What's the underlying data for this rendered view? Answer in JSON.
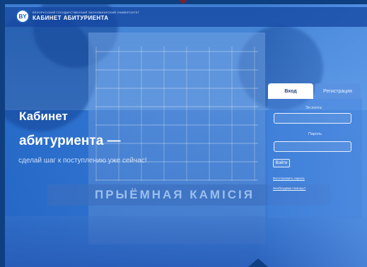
{
  "header": {
    "university": "БЕЛОРУССКИЙ ГОСУДАРСТВЕННЫЙ ЭКОНОМИЧЕСКИЙ УНИВЕРСИТЕТ",
    "cabinet": "КАБИНЕТ АБИТУРИЕНТА",
    "logo_text": "BY"
  },
  "hero": {
    "title_line1": "Кабинет",
    "title_line2": "абитуриента —",
    "subtitle": "сделай шаг к поступлению уже сейчас!"
  },
  "background": {
    "sign": "ПРЫЁМНАЯ КАМІСІЯ"
  },
  "auth": {
    "tab_login": "Вход",
    "tab_register": "Регистрация",
    "email_label": "Эл.почта",
    "password_label": "Пароль",
    "email_value": "",
    "password_value": "",
    "login_button": "Войти",
    "restore_link": "Восстановить пароль",
    "help_link": "Необходима помощь?"
  },
  "colors": {
    "frame": "#0e3f80",
    "accent_tab": "#7a2230",
    "panel": "#4682dc"
  }
}
